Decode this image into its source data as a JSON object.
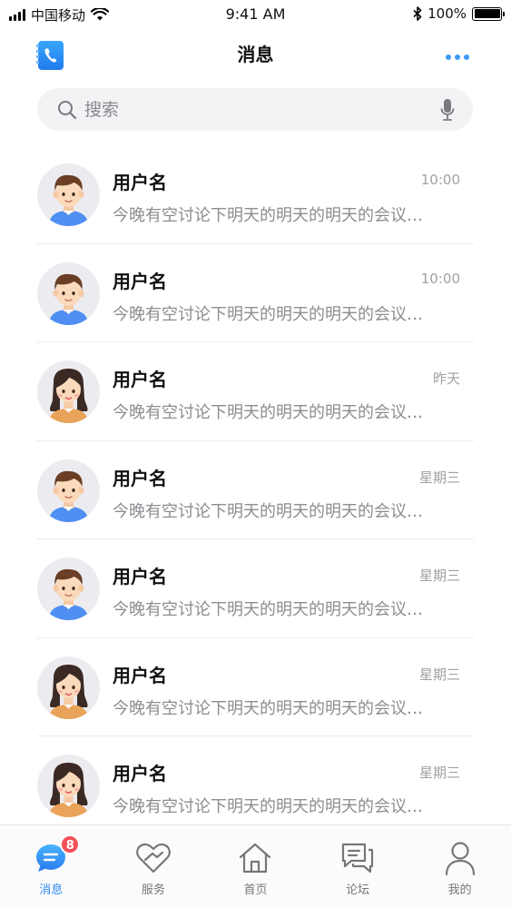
{
  "status_bar": {
    "carrier": "中国移动",
    "time": "9:41 AM",
    "battery": "100%"
  },
  "header": {
    "title": "消息",
    "app_icon": "contacts-book-phone-icon",
    "more_icon": "more-dots-icon"
  },
  "search": {
    "placeholder": "搜索",
    "value": "",
    "icons": [
      "search-icon",
      "microphone-icon"
    ]
  },
  "messages": [
    {
      "name": "用户名",
      "time": "10:00",
      "preview": "今晚有空讨论下明天的明天的明天的会议…",
      "avatar": "male"
    },
    {
      "name": "用户名",
      "time": "10:00",
      "preview": "今晚有空讨论下明天的明天的明天的会议…",
      "avatar": "male"
    },
    {
      "name": "用户名",
      "time": "昨天",
      "preview": "今晚有空讨论下明天的明天的明天的会议…",
      "avatar": "female"
    },
    {
      "name": "用户名",
      "time": "星期三",
      "preview": "今晚有空讨论下明天的明天的明天的会议…",
      "avatar": "male"
    },
    {
      "name": "用户名",
      "time": "星期三",
      "preview": "今晚有空讨论下明天的明天的明天的会议…",
      "avatar": "male"
    },
    {
      "name": "用户名",
      "time": "星期三",
      "preview": "今晚有空讨论下明天的明天的明天的会议…",
      "avatar": "female"
    },
    {
      "name": "用户名",
      "time": "星期三",
      "preview": "今晚有空讨论下明天的明天的明天的会议…",
      "avatar": "female"
    }
  ],
  "tabbar": {
    "tabs": [
      {
        "label": "消息",
        "icon": "message-bubble-icon",
        "active": true,
        "badge": "8"
      },
      {
        "label": "服务",
        "icon": "heart-handshake-icon",
        "active": false
      },
      {
        "label": "首页",
        "icon": "home-icon",
        "active": false
      },
      {
        "label": "论坛",
        "icon": "forum-chat-icon",
        "active": false
      },
      {
        "label": "我的",
        "icon": "user-profile-icon",
        "active": false
      }
    ]
  },
  "colors": {
    "accent": "#2f8af5",
    "badge": "#f5505a",
    "muted_text": "#8d8d92"
  }
}
